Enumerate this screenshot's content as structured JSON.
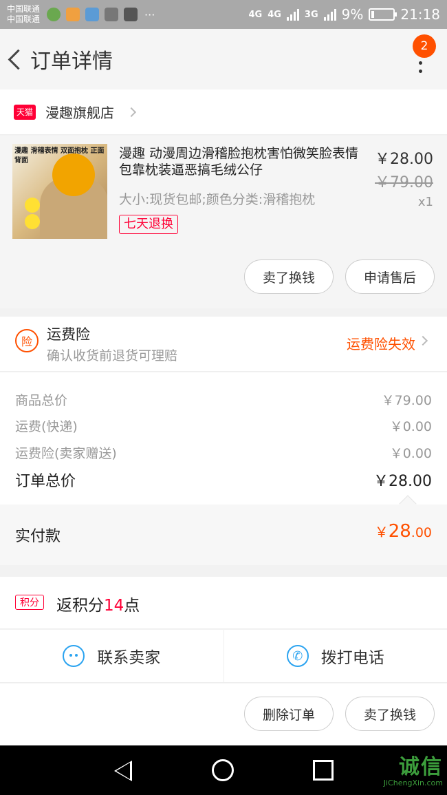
{
  "status_bar": {
    "carrier1": "中国联通",
    "carrier2": "中国联通",
    "net1": "4G",
    "net2": "4G",
    "net3": "3G",
    "battery": "9%",
    "time": "21:18"
  },
  "header": {
    "title": "订单详情",
    "badge": "2"
  },
  "store": {
    "badge": "天猫",
    "name": "漫趣旗舰店"
  },
  "item": {
    "thumb_text": "漫趣 滑稽表情 双面抱枕 正面 背面",
    "title": "漫趣 动漫周边滑稽脸抱枕害怕微笑脸表情包靠枕装逼恶搞毛绒公仔",
    "spec": "大小:现货包邮;颜色分类:滑稽抱枕",
    "tag": "七天退换",
    "price_now": "￥28.00",
    "price_old": "￥79.00",
    "qty": "x1",
    "btn_sell": "卖了换钱",
    "btn_after_sale": "申请售后"
  },
  "insurance": {
    "icon_text": "险",
    "title": "运费险",
    "subtitle": "确认收货前退货可理赔",
    "status": "运费险失效"
  },
  "summary": {
    "rows": [
      {
        "label": "商品总价",
        "value": "￥79.00"
      },
      {
        "label": "运费(快递)",
        "value": "￥0.00"
      },
      {
        "label": "运费险(卖家赠送)",
        "value": "￥0.00"
      }
    ],
    "total_label": "订单总价",
    "total_value": "￥28.00"
  },
  "paid": {
    "label": "实付款",
    "currency": "￥",
    "integer": "28",
    "decimal": ".00"
  },
  "points": {
    "icon_text": "积分",
    "prefix": "返积分",
    "number": "14",
    "suffix": "点"
  },
  "contact": {
    "seller": "联系卖家",
    "phone": "拨打电话"
  },
  "bottom_actions": {
    "delete": "删除订单",
    "sell": "卖了换钱"
  },
  "watermark": {
    "main": "诚信",
    "sub": "JiChengXin.com"
  },
  "colors": {
    "accent": "#ff5000",
    "tmall_red": "#ff0036",
    "link_blue": "#2aa3f0"
  }
}
